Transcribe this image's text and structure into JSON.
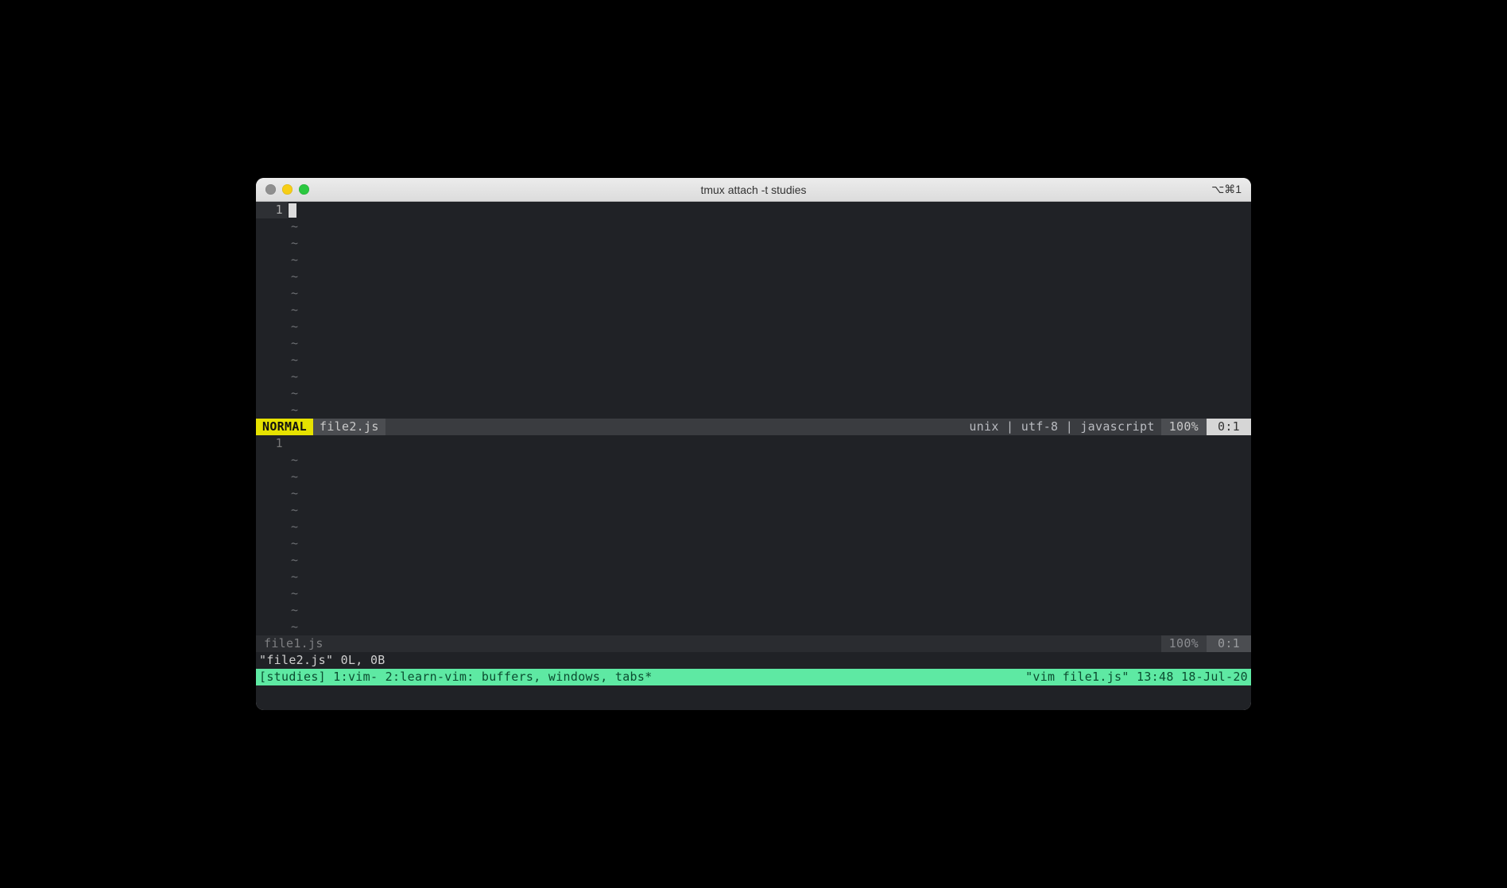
{
  "window": {
    "title": "tmux attach -t studies",
    "shortcut": "⌥⌘1"
  },
  "panes": [
    {
      "line_number": "1",
      "tilde_count": 12,
      "active": true,
      "status": {
        "mode": "NORMAL",
        "file": "file2.js",
        "info": "unix | utf-8 | javascript",
        "percent": "100%",
        "position": "0:1"
      }
    },
    {
      "line_number": "1",
      "tilde_count": 11,
      "active": false,
      "status": {
        "file": "file1.js",
        "percent": "100%",
        "position": "0:1"
      }
    }
  ],
  "message_line": "\"file2.js\" 0L, 0B",
  "tmux": {
    "left": "[studies] 1:vim- 2:learn-vim: buffers, windows, tabs*",
    "right": "\"vim file1.js\" 13:48 18-Jul-20"
  }
}
